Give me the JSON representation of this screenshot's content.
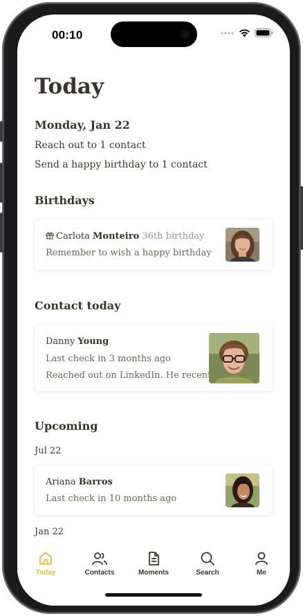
{
  "status_bar": {
    "time": "00:10"
  },
  "page": {
    "title": "Today"
  },
  "summary": {
    "date": "Monday, Jan 22",
    "lines": [
      "Reach out to 1 contact",
      "Send a happy birthday to 1 contact"
    ]
  },
  "birthdays": {
    "title": "Birthdays",
    "items": [
      {
        "first_name": "Carlota",
        "last_name": "Monteiro",
        "detail": "36th birthday",
        "note": "Remember to wish a happy birthday"
      }
    ]
  },
  "contact_today": {
    "title": "Contact today",
    "items": [
      {
        "first_name": "Danny",
        "last_name": "Young",
        "last_check": "Last check in 3 months ago",
        "note": "Reached out on LinkedIn. He recent..."
      }
    ]
  },
  "upcoming": {
    "title": "Upcoming",
    "groups": [
      {
        "date": "Jul 22",
        "items": [
          {
            "first_name": "Ariana",
            "last_name": "Barros",
            "last_check": "Last check in 10 months ago"
          }
        ]
      },
      {
        "date": "Jan 22",
        "items": []
      }
    ]
  },
  "tabbar": {
    "active_color": "#e8b83a",
    "items": [
      {
        "label": "Today",
        "icon": "home-icon",
        "active": true
      },
      {
        "label": "Contacts",
        "icon": "contacts-icon",
        "active": false
      },
      {
        "label": "Moments",
        "icon": "document-icon",
        "active": false
      },
      {
        "label": "Search",
        "icon": "search-icon",
        "active": false
      },
      {
        "label": "Me",
        "icon": "person-icon",
        "active": false
      }
    ]
  }
}
